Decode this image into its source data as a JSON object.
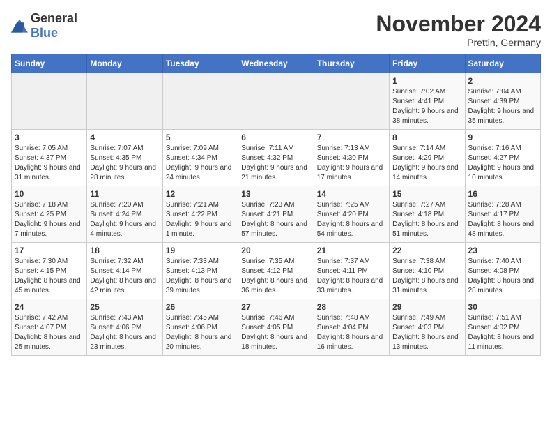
{
  "header": {
    "logo_general": "General",
    "logo_blue": "Blue",
    "month_title": "November 2024",
    "location": "Prettin, Germany"
  },
  "weekdays": [
    "Sunday",
    "Monday",
    "Tuesday",
    "Wednesday",
    "Thursday",
    "Friday",
    "Saturday"
  ],
  "weeks": [
    [
      {
        "day": "",
        "sunrise": "",
        "sunset": "",
        "daylight": "",
        "empty": true
      },
      {
        "day": "",
        "sunrise": "",
        "sunset": "",
        "daylight": "",
        "empty": true
      },
      {
        "day": "",
        "sunrise": "",
        "sunset": "",
        "daylight": "",
        "empty": true
      },
      {
        "day": "",
        "sunrise": "",
        "sunset": "",
        "daylight": "",
        "empty": true
      },
      {
        "day": "",
        "sunrise": "",
        "sunset": "",
        "daylight": "",
        "empty": true
      },
      {
        "day": "1",
        "sunrise": "Sunrise: 7:02 AM",
        "sunset": "Sunset: 4:41 PM",
        "daylight": "Daylight: 9 hours and 38 minutes."
      },
      {
        "day": "2",
        "sunrise": "Sunrise: 7:04 AM",
        "sunset": "Sunset: 4:39 PM",
        "daylight": "Daylight: 9 hours and 35 minutes."
      }
    ],
    [
      {
        "day": "3",
        "sunrise": "Sunrise: 7:05 AM",
        "sunset": "Sunset: 4:37 PM",
        "daylight": "Daylight: 9 hours and 31 minutes."
      },
      {
        "day": "4",
        "sunrise": "Sunrise: 7:07 AM",
        "sunset": "Sunset: 4:35 PM",
        "daylight": "Daylight: 9 hours and 28 minutes."
      },
      {
        "day": "5",
        "sunrise": "Sunrise: 7:09 AM",
        "sunset": "Sunset: 4:34 PM",
        "daylight": "Daylight: 9 hours and 24 minutes."
      },
      {
        "day": "6",
        "sunrise": "Sunrise: 7:11 AM",
        "sunset": "Sunset: 4:32 PM",
        "daylight": "Daylight: 9 hours and 21 minutes."
      },
      {
        "day": "7",
        "sunrise": "Sunrise: 7:13 AM",
        "sunset": "Sunset: 4:30 PM",
        "daylight": "Daylight: 9 hours and 17 minutes."
      },
      {
        "day": "8",
        "sunrise": "Sunrise: 7:14 AM",
        "sunset": "Sunset: 4:29 PM",
        "daylight": "Daylight: 9 hours and 14 minutes."
      },
      {
        "day": "9",
        "sunrise": "Sunrise: 7:16 AM",
        "sunset": "Sunset: 4:27 PM",
        "daylight": "Daylight: 9 hours and 10 minutes."
      }
    ],
    [
      {
        "day": "10",
        "sunrise": "Sunrise: 7:18 AM",
        "sunset": "Sunset: 4:25 PM",
        "daylight": "Daylight: 9 hours and 7 minutes."
      },
      {
        "day": "11",
        "sunrise": "Sunrise: 7:20 AM",
        "sunset": "Sunset: 4:24 PM",
        "daylight": "Daylight: 9 hours and 4 minutes."
      },
      {
        "day": "12",
        "sunrise": "Sunrise: 7:21 AM",
        "sunset": "Sunset: 4:22 PM",
        "daylight": "Daylight: 9 hours and 1 minute."
      },
      {
        "day": "13",
        "sunrise": "Sunrise: 7:23 AM",
        "sunset": "Sunset: 4:21 PM",
        "daylight": "Daylight: 8 hours and 57 minutes."
      },
      {
        "day": "14",
        "sunrise": "Sunrise: 7:25 AM",
        "sunset": "Sunset: 4:20 PM",
        "daylight": "Daylight: 8 hours and 54 minutes."
      },
      {
        "day": "15",
        "sunrise": "Sunrise: 7:27 AM",
        "sunset": "Sunset: 4:18 PM",
        "daylight": "Daylight: 8 hours and 51 minutes."
      },
      {
        "day": "16",
        "sunrise": "Sunrise: 7:28 AM",
        "sunset": "Sunset: 4:17 PM",
        "daylight": "Daylight: 8 hours and 48 minutes."
      }
    ],
    [
      {
        "day": "17",
        "sunrise": "Sunrise: 7:30 AM",
        "sunset": "Sunset: 4:15 PM",
        "daylight": "Daylight: 8 hours and 45 minutes."
      },
      {
        "day": "18",
        "sunrise": "Sunrise: 7:32 AM",
        "sunset": "Sunset: 4:14 PM",
        "daylight": "Daylight: 8 hours and 42 minutes."
      },
      {
        "day": "19",
        "sunrise": "Sunrise: 7:33 AM",
        "sunset": "Sunset: 4:13 PM",
        "daylight": "Daylight: 8 hours and 39 minutes."
      },
      {
        "day": "20",
        "sunrise": "Sunrise: 7:35 AM",
        "sunset": "Sunset: 4:12 PM",
        "daylight": "Daylight: 8 hours and 36 minutes."
      },
      {
        "day": "21",
        "sunrise": "Sunrise: 7:37 AM",
        "sunset": "Sunset: 4:11 PM",
        "daylight": "Daylight: 8 hours and 33 minutes."
      },
      {
        "day": "22",
        "sunrise": "Sunrise: 7:38 AM",
        "sunset": "Sunset: 4:10 PM",
        "daylight": "Daylight: 8 hours and 31 minutes."
      },
      {
        "day": "23",
        "sunrise": "Sunrise: 7:40 AM",
        "sunset": "Sunset: 4:08 PM",
        "daylight": "Daylight: 8 hours and 28 minutes."
      }
    ],
    [
      {
        "day": "24",
        "sunrise": "Sunrise: 7:42 AM",
        "sunset": "Sunset: 4:07 PM",
        "daylight": "Daylight: 8 hours and 25 minutes."
      },
      {
        "day": "25",
        "sunrise": "Sunrise: 7:43 AM",
        "sunset": "Sunset: 4:06 PM",
        "daylight": "Daylight: 8 hours and 23 minutes."
      },
      {
        "day": "26",
        "sunrise": "Sunrise: 7:45 AM",
        "sunset": "Sunset: 4:06 PM",
        "daylight": "Daylight: 8 hours and 20 minutes."
      },
      {
        "day": "27",
        "sunrise": "Sunrise: 7:46 AM",
        "sunset": "Sunset: 4:05 PM",
        "daylight": "Daylight: 8 hours and 18 minutes."
      },
      {
        "day": "28",
        "sunrise": "Sunrise: 7:48 AM",
        "sunset": "Sunset: 4:04 PM",
        "daylight": "Daylight: 8 hours and 16 minutes."
      },
      {
        "day": "29",
        "sunrise": "Sunrise: 7:49 AM",
        "sunset": "Sunset: 4:03 PM",
        "daylight": "Daylight: 8 hours and 13 minutes."
      },
      {
        "day": "30",
        "sunrise": "Sunrise: 7:51 AM",
        "sunset": "Sunset: 4:02 PM",
        "daylight": "Daylight: 8 hours and 11 minutes."
      }
    ]
  ]
}
